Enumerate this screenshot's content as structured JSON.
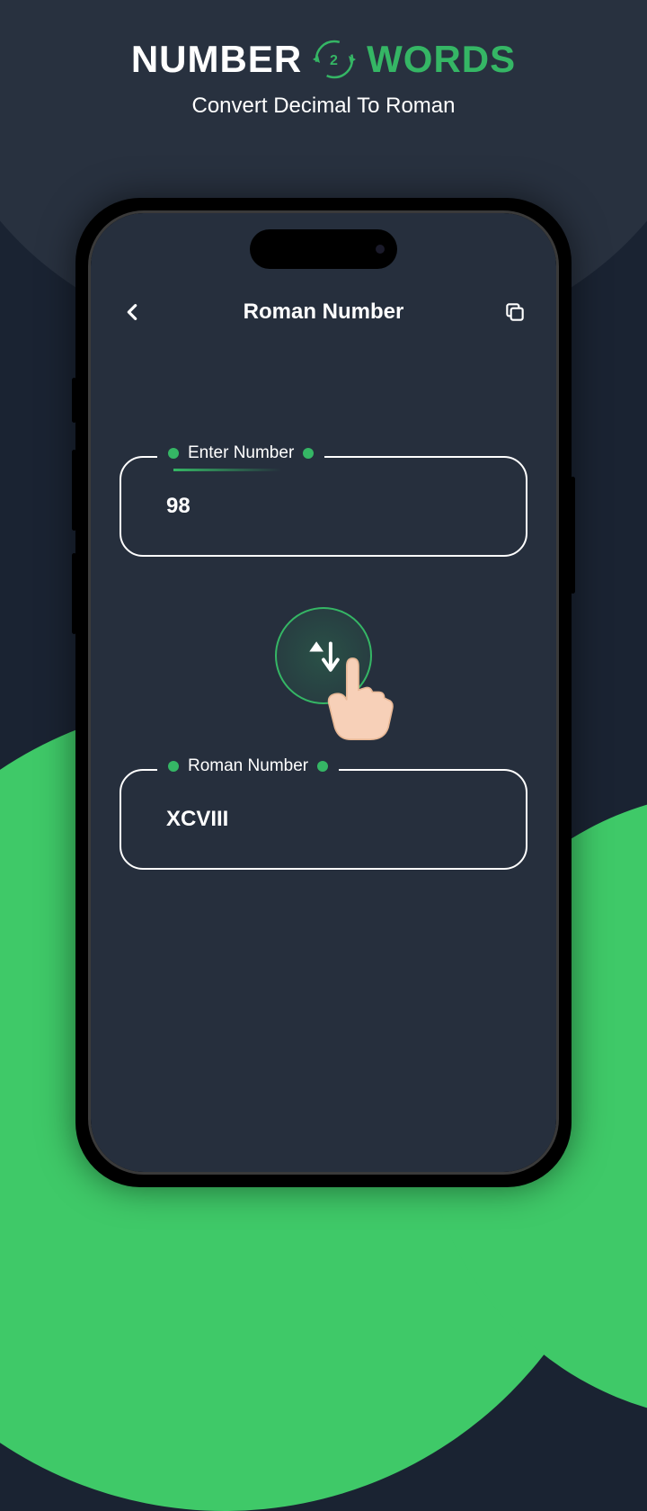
{
  "logo": {
    "part1": "NUMBER",
    "badge": "2",
    "part2": "WORDS"
  },
  "subtitle": "Convert Decimal To Roman",
  "app": {
    "title": "Roman Number",
    "input": {
      "label": "Enter Number",
      "value": "98"
    },
    "output": {
      "label": "Roman Number",
      "value": "XCVIII"
    }
  }
}
